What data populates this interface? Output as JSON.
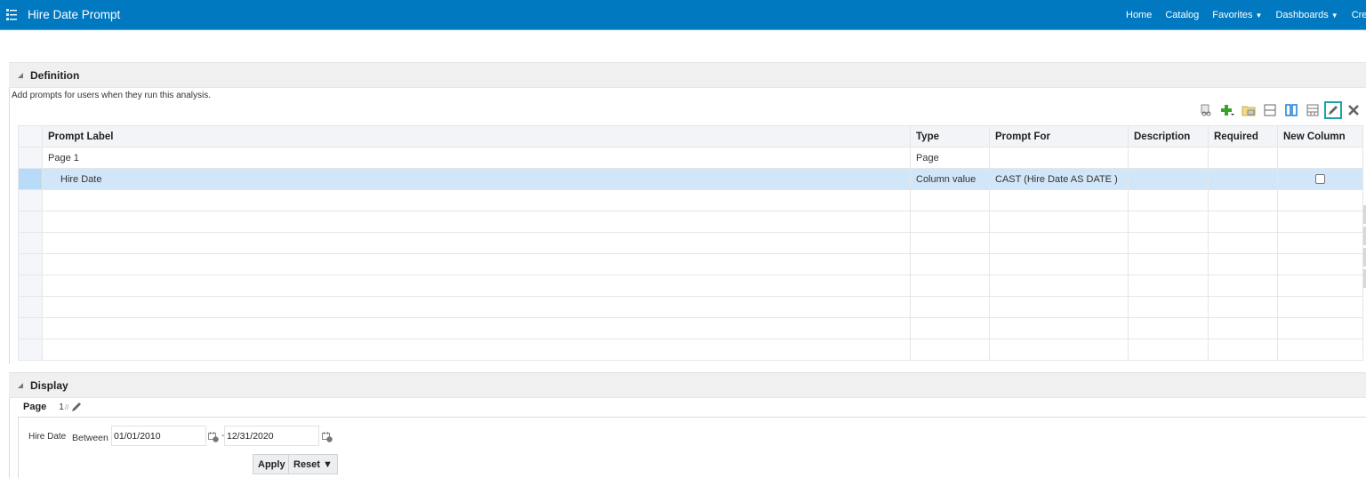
{
  "header": {
    "title": "Hire Date Prompt",
    "nav": [
      {
        "label": "Home",
        "dropdown": false
      },
      {
        "label": "Catalog",
        "dropdown": false
      },
      {
        "label": "Favorites",
        "dropdown": true
      },
      {
        "label": "Dashboards",
        "dropdown": true
      },
      {
        "label": "Crea",
        "dropdown": false
      }
    ]
  },
  "definition": {
    "title": "Definition",
    "description": "Add prompts for users when they run this analysis.",
    "toolbar": [
      {
        "icon": "preview-icon"
      },
      {
        "icon": "add-prompt-icon"
      },
      {
        "icon": "folder-icon"
      },
      {
        "icon": "add-row-icon"
      },
      {
        "icon": "add-column-icon"
      },
      {
        "icon": "new-page-icon"
      },
      {
        "icon": "edit-icon",
        "active": true
      },
      {
        "icon": "delete-icon"
      }
    ],
    "columns": [
      "Prompt Label",
      "Type",
      "Prompt For",
      "Description",
      "Required",
      "New Column"
    ],
    "rows": [
      {
        "label": "Page 1",
        "type": "Page",
        "prompt_for": "",
        "description": "",
        "required": "",
        "new_column": null,
        "indent": false,
        "selected": false
      },
      {
        "label": "Hire Date",
        "type": "Column value",
        "prompt_for": "CAST (Hire Date AS DATE )",
        "description": "",
        "required": "",
        "new_column": false,
        "indent": true,
        "selected": true
      }
    ],
    "empty_rows": 8
  },
  "display": {
    "title": "Display",
    "page_label": "Page",
    "page_number": "1",
    "prompt_label": "Hire Date",
    "operator": "Between",
    "from_date": "01/01/2010",
    "separator": "-",
    "to_date": "12/31/2020",
    "apply_label": "Apply",
    "reset_label": "Reset ▼"
  },
  "colors": {
    "brand": "#0079c1",
    "selected_row": "#d1e6f8",
    "active_tool_border": "#1aa6a6"
  }
}
